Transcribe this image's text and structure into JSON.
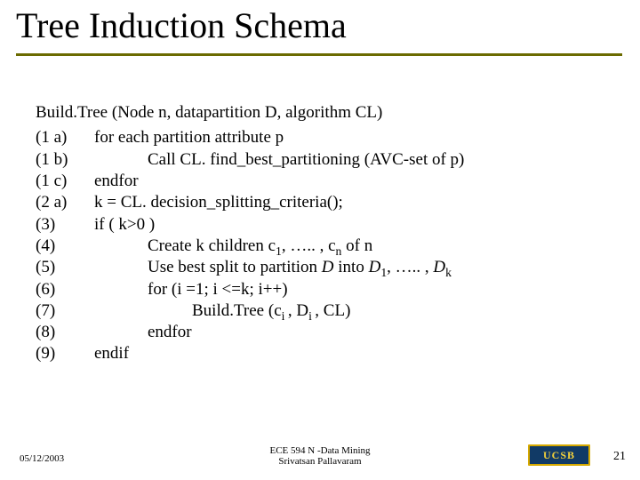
{
  "title": "Tree Induction Schema",
  "signature": {
    "fn": "Build.Tree",
    "args": "(Node n, datapartition D, algorithm CL)"
  },
  "lines": [
    {
      "label": "(1 a)",
      "indent": 1,
      "parts": [
        {
          "t": "for each partition attribute p"
        }
      ]
    },
    {
      "label": "(1 b)",
      "indent": 2,
      "parts": [
        {
          "t": "Call CL. find_best_partitioning (AVC-set of p)"
        }
      ]
    },
    {
      "label": "(1 c)",
      "indent": 1,
      "parts": [
        {
          "t": "endfor"
        }
      ]
    },
    {
      "label": "(2 a)",
      "indent": 1,
      "parts": [
        {
          "t": "k = CL. decision_splitting_criteria();"
        }
      ]
    },
    {
      "label": "(3)",
      "indent": 1,
      "parts": [
        {
          "t": "if ( k>0 )"
        }
      ]
    },
    {
      "label": "(4)",
      "indent": 2,
      "parts": [
        {
          "t": "Create k children c"
        },
        {
          "t": "1",
          "sub": true
        },
        {
          "t": ", ….. , c"
        },
        {
          "t": "n",
          "sub": true
        },
        {
          "t": " of n"
        }
      ]
    },
    {
      "label": "(5)",
      "indent": 2,
      "parts": [
        {
          "t": "Use best split to partition "
        },
        {
          "t": "D",
          "it": true
        },
        {
          "t": " into "
        },
        {
          "t": "D",
          "it": true
        },
        {
          "t": "1",
          "sub": true
        },
        {
          "t": ", ….. , "
        },
        {
          "t": "D",
          "it": true
        },
        {
          "t": "k",
          "sub": true
        }
      ]
    },
    {
      "label": "(6)",
      "indent": 2,
      "parts": [
        {
          "t": "for (i =1; i <=k; i++)"
        }
      ]
    },
    {
      "label": "(7)",
      "indent": 3,
      "parts": [
        {
          "t": "Build.Tree (c"
        },
        {
          "t": "i ",
          "sub": true
        },
        {
          "t": ", D"
        },
        {
          "t": "i ",
          "sub": true
        },
        {
          "t": ", CL)"
        }
      ]
    },
    {
      "label": "(8)",
      "indent": 2,
      "parts": [
        {
          "t": "endfor"
        }
      ]
    },
    {
      "label": "(9)",
      "indent": 1,
      "parts": [
        {
          "t": "endif"
        }
      ]
    }
  ],
  "footer": {
    "date": "05/12/2003",
    "center_line1": "ECE 594 N -Data Mining",
    "center_line2": "Srivatsan Pallavaram",
    "logo_text": "UCSB",
    "page": "21"
  }
}
